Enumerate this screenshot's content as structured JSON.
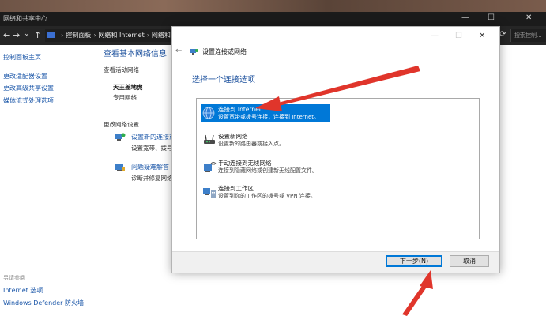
{
  "window": {
    "title": "网络和共享中心",
    "minimize_glyph": "—",
    "maximize_glyph": "☐",
    "close_glyph": "✕"
  },
  "nav": {
    "back_glyph": "←",
    "forward_glyph": "→",
    "recent_glyph": "⌄",
    "up_glyph": "↑",
    "breadcrumbs": [
      "控制面板",
      "网络和 Internet",
      "网络和共享中心"
    ],
    "breadcrumb_separator": "›",
    "refresh_glyph": "⟳",
    "search_placeholder": "搜索控制..."
  },
  "sidebar": {
    "home": "控制面板主页",
    "links": [
      "更改适配器设置",
      "更改高级共享设置",
      "媒体流式处理选项"
    ],
    "see_also": "另请参阅",
    "see_also_links": [
      "Internet 选项",
      "Windows Defender 防火墙"
    ]
  },
  "main": {
    "title": "查看基本网络信息",
    "active_networks_label": "查看活动网络",
    "network_name": "天王盖地虎",
    "network_type": "专用网络",
    "change_settings_label": "更改网络设置",
    "tasks": [
      {
        "link": "设置新的连接或",
        "desc": "设置宽带、拨号"
      },
      {
        "link": "问题疑难解答",
        "desc": "诊断并修复网络"
      }
    ]
  },
  "dialog": {
    "title": "设置连接或网络",
    "back_glyph": "←",
    "minimize_glyph": "—",
    "maximize_glyph": "☐",
    "close_glyph": "✕",
    "instruction": "选择一个连接选项",
    "options": [
      {
        "title": "连接到 Internet",
        "desc": "设置宽带或拨号连接，连接到 Internet。",
        "selected": true
      },
      {
        "title": "设置新网络",
        "desc": "设置新的路由器或接入点。",
        "selected": false
      },
      {
        "title": "手动连接到无线网络",
        "desc": "连接到隐藏网络或创建新无线配置文件。",
        "selected": false
      },
      {
        "title": "连接到工作区",
        "desc": "设置到你的工作区的拨号或 VPN 连接。",
        "selected": false
      }
    ],
    "next_button": "下一步(N)",
    "cancel_button": "取消"
  },
  "annotation_color": "#e0352b"
}
